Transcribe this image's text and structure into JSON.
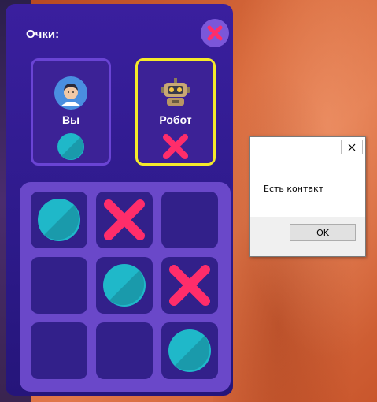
{
  "game": {
    "score_label": "Очки:",
    "close_icon": "close-x-icon",
    "players": [
      {
        "name": "Вы",
        "avatar": "user-avatar-icon",
        "mark": "O",
        "active": false
      },
      {
        "name": "Робот",
        "avatar": "robot-avatar-icon",
        "mark": "X",
        "active": true
      }
    ],
    "board": [
      [
        "O",
        "X",
        ""
      ],
      [
        "",
        "O",
        "X"
      ],
      [
        "",
        "",
        "O"
      ]
    ],
    "colors": {
      "o_mark": "#1fb8c9",
      "x_mark": "#ff2d6a",
      "active_border": "#f5ea2b"
    }
  },
  "dialog": {
    "message": "Есть контакт",
    "ok_label": "OK"
  }
}
